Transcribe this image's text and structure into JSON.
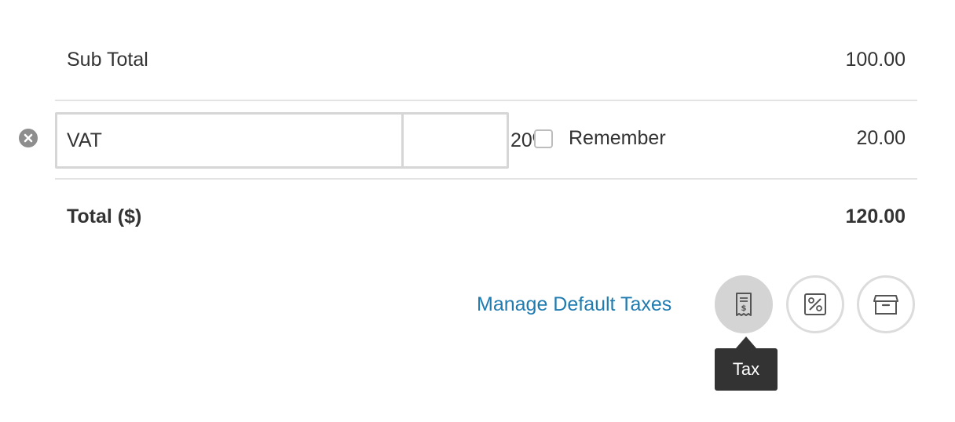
{
  "summary": {
    "subtotal_label": "Sub Total",
    "subtotal_value": "100.00",
    "total_label": "Total ($)",
    "total_value": "120.00"
  },
  "tax_line": {
    "name_value": "VAT",
    "rate_value": "20%",
    "remember_label": "Remember",
    "remember_checked": false,
    "amount": "20.00",
    "remove_icon": "close-circle-icon"
  },
  "actions": {
    "manage_link": "Manage Default Taxes",
    "buttons": [
      {
        "name": "tax",
        "icon": "receipt-icon"
      },
      {
        "name": "discount",
        "icon": "percent-icon"
      },
      {
        "name": "shipping",
        "icon": "archive-box-icon"
      }
    ],
    "tooltip": "Tax"
  },
  "colors": {
    "link": "#1f7bb0",
    "tooltip_bg": "#333333",
    "active_button_bg": "#d4d4d4"
  }
}
